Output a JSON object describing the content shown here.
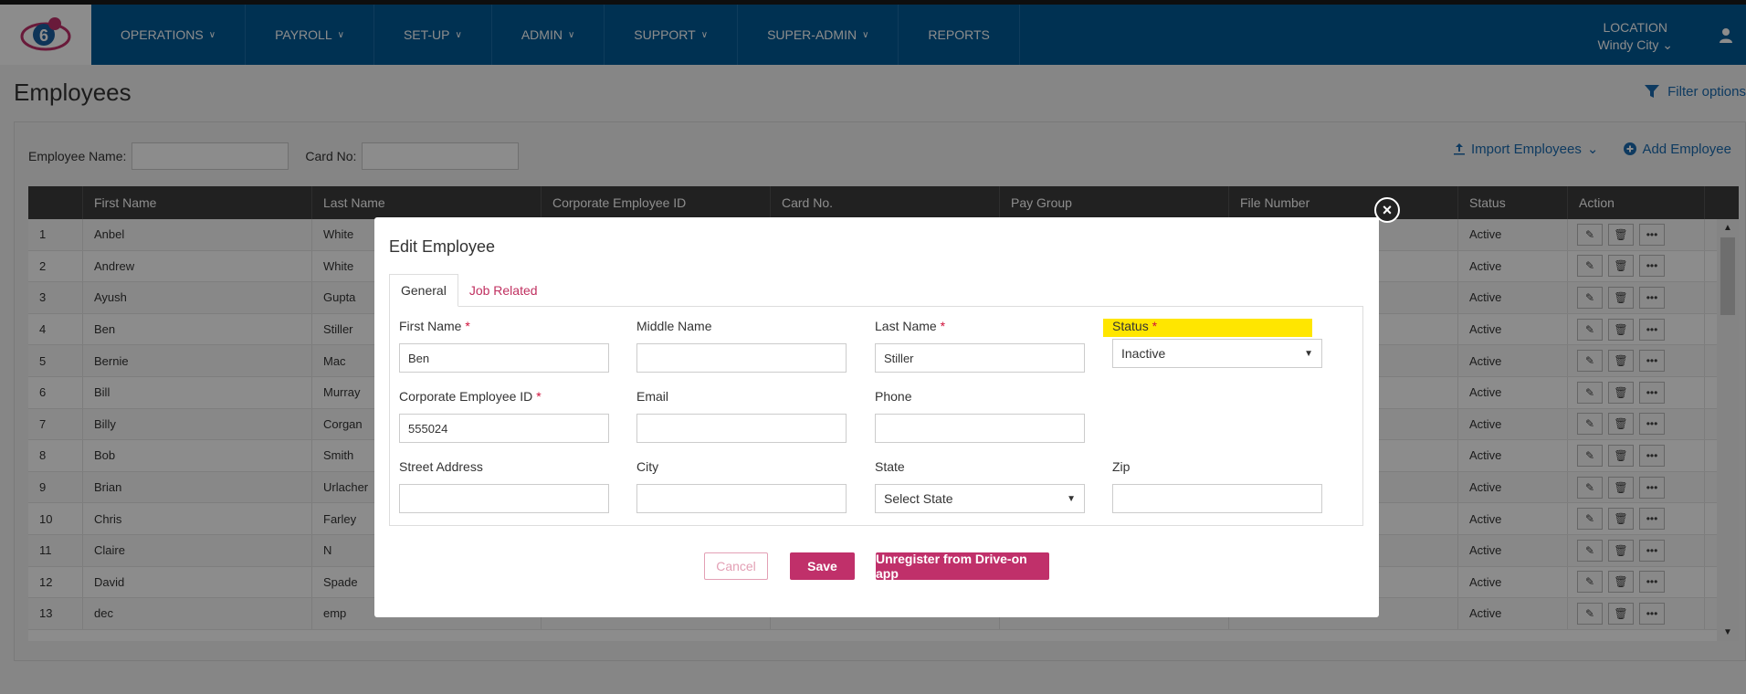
{
  "nav": {
    "items": [
      {
        "label": "OPERATIONS",
        "chevron": true
      },
      {
        "label": "PAYROLL",
        "chevron": true
      },
      {
        "label": "SET-UP",
        "chevron": true
      },
      {
        "label": "ADMIN",
        "chevron": true
      },
      {
        "label": "SUPPORT",
        "chevron": true
      },
      {
        "label": "SUPER-ADMIN",
        "chevron": true
      },
      {
        "label": "REPORTS",
        "chevron": false
      }
    ],
    "location_label": "LOCATION",
    "location_value": "Windy City"
  },
  "page": {
    "title": "Employees",
    "filter_label": "Filter options"
  },
  "search": {
    "employee_name_label": "Employee Name:",
    "card_no_label": "Card No:"
  },
  "toolbar": {
    "import_label": "Import Employees",
    "add_label": "Add Employee"
  },
  "grid": {
    "columns": [
      "",
      "First Name",
      "Last Name",
      "Corporate Employee ID",
      "Card No.",
      "Pay Group",
      "File Number",
      "Status",
      "Action"
    ],
    "rows": [
      {
        "n": "1",
        "first": "Anbel",
        "last": "White",
        "status": "Active"
      },
      {
        "n": "2",
        "first": "Andrew",
        "last": "White",
        "status": "Active"
      },
      {
        "n": "3",
        "first": "Ayush",
        "last": "Gupta",
        "status": "Active"
      },
      {
        "n": "4",
        "first": "Ben",
        "last": "Stiller",
        "status": "Active"
      },
      {
        "n": "5",
        "first": "Bernie",
        "last": "Mac",
        "status": "Active"
      },
      {
        "n": "6",
        "first": "Bill",
        "last": "Murray",
        "status": "Active"
      },
      {
        "n": "7",
        "first": "Billy",
        "last": "Corgan",
        "status": "Active"
      },
      {
        "n": "8",
        "first": "Bob",
        "last": "Smith",
        "status": "Active"
      },
      {
        "n": "9",
        "first": "Brian",
        "last": "Urlacher",
        "status": "Active"
      },
      {
        "n": "10",
        "first": "Chris",
        "last": "Farley",
        "status": "Active"
      },
      {
        "n": "11",
        "first": "Claire",
        "last": "N",
        "status": "Active"
      },
      {
        "n": "12",
        "first": "David",
        "last": "Spade",
        "status": "Active"
      },
      {
        "n": "13",
        "first": "dec",
        "last": "emp",
        "status": "Active"
      }
    ]
  },
  "modal": {
    "title": "Edit Employee",
    "tabs": [
      "General",
      "Job Related"
    ],
    "fields": {
      "first_name": {
        "label": "First Name",
        "value": "Ben"
      },
      "middle_name": {
        "label": "Middle Name",
        "value": ""
      },
      "last_name": {
        "label": "Last Name",
        "value": "Stiller"
      },
      "status": {
        "label": "Status",
        "value": "Inactive"
      },
      "corp_id": {
        "label": "Corporate Employee ID",
        "value": "555024"
      },
      "email": {
        "label": "Email",
        "value": ""
      },
      "phone": {
        "label": "Phone",
        "value": ""
      },
      "street": {
        "label": "Street Address",
        "value": ""
      },
      "city": {
        "label": "City",
        "value": ""
      },
      "state": {
        "label": "State",
        "value": "Select State"
      },
      "zip": {
        "label": "Zip",
        "value": ""
      }
    },
    "buttons": {
      "cancel": "Cancel",
      "save": "Save",
      "unregister": "Unregister from Drive-on app"
    },
    "highlight_color": "#ffe600"
  }
}
